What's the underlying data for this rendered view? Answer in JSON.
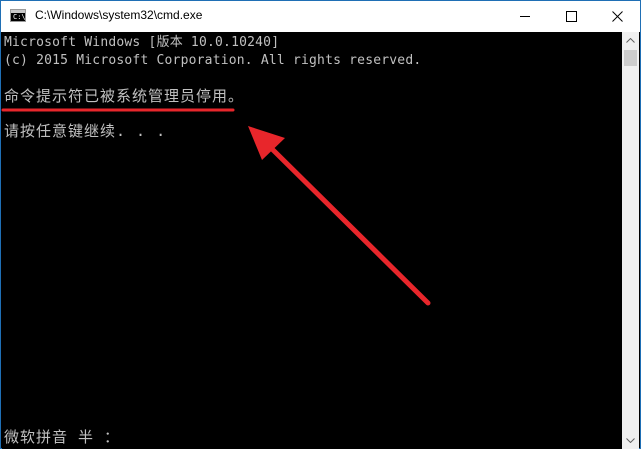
{
  "window": {
    "title": "C:\\Windows\\system32\\cmd.exe",
    "icon": "cmd-icon",
    "icon_glyph": "C:\\",
    "controls": [
      "minimize-icon",
      "maximize-icon",
      "close-icon"
    ]
  },
  "console": {
    "lines": [
      "Microsoft Windows [版本 10.0.10240]",
      "(c) 2015 Microsoft Corporation. All rights reserved.",
      "命令提示符已被系统管理员停用。",
      "请按任意键继续. . .",
      "微软拼音 半 ："
    ]
  },
  "annotation": {
    "color": "#e8262b"
  },
  "colors": {
    "console_bg": "#000000",
    "console_text": "#c0c0c0",
    "titlebar_bg": "#ffffff",
    "window_border": "#1f6fb5"
  }
}
